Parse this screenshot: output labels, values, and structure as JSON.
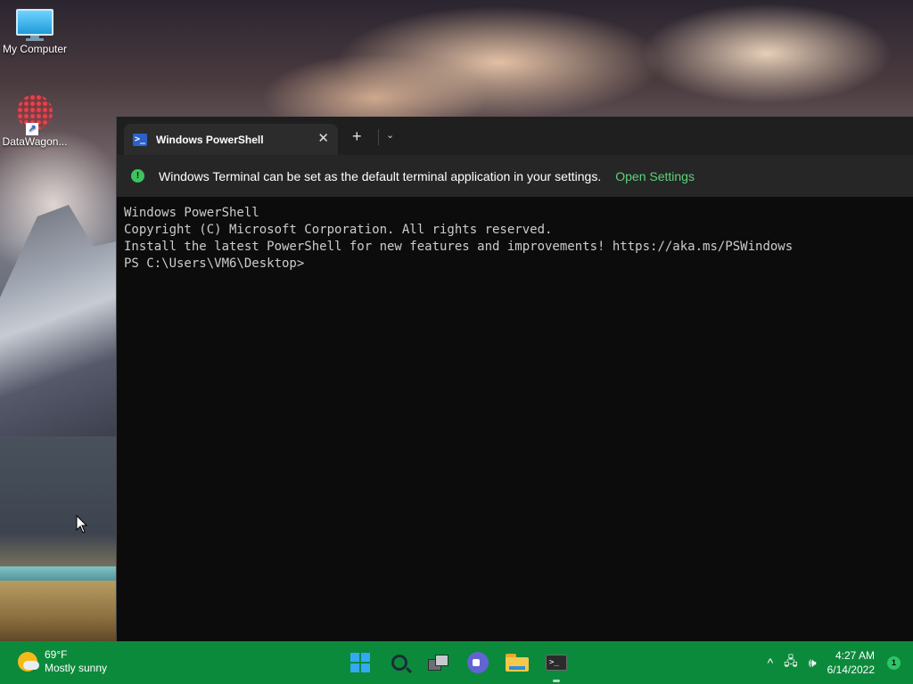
{
  "desktop": {
    "icons": [
      {
        "label": "My Computer",
        "icon": "computer-icon"
      },
      {
        "label": "DataWagon...",
        "icon": "datawagon-icon"
      }
    ]
  },
  "terminal": {
    "tab": {
      "title": "Windows PowerShell",
      "icon": "powershell-icon",
      "close_glyph": "✕"
    },
    "new_tab_glyph": "+",
    "dropdown_glyph": "⌄",
    "infobar": {
      "icon_glyph": "!",
      "message": "Windows Terminal can be set as the default terminal application in your settings.",
      "link": "Open Settings"
    },
    "console": {
      "lines": [
        "Windows PowerShell",
        "Copyright (C) Microsoft Corporation. All rights reserved.",
        "",
        "Install the latest PowerShell for new features and improvements! https://aka.ms/PSWindows",
        "",
        "PS C:\\Users\\VM6\\Desktop>"
      ]
    }
  },
  "taskbar": {
    "weather": {
      "temp": "69°F",
      "condition": "Mostly sunny"
    },
    "apps": [
      "start-icon",
      "search-icon",
      "task-view-icon",
      "teams-chat-icon",
      "file-explorer-icon",
      "terminal-icon"
    ],
    "tray": {
      "chevron_glyph": "^",
      "network_glyph": "🖧",
      "volume_glyph": "🕪",
      "time": "4:27 AM",
      "date": "6/14/2022",
      "notification_count": "1"
    },
    "accent": "#0c8a3c"
  }
}
